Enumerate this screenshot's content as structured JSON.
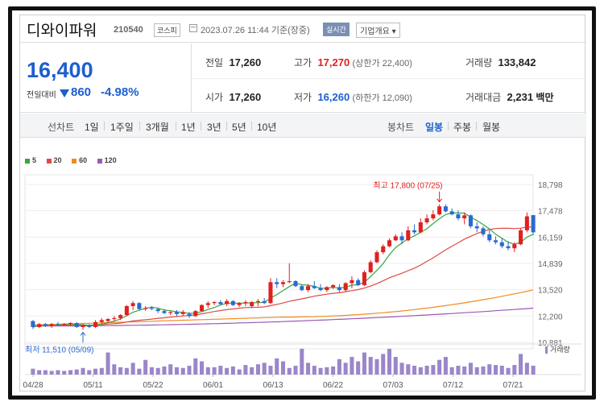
{
  "header": {
    "name": "디와이파워",
    "code": "210540",
    "market": "코스피",
    "time": "2023.07.26 11:44 기준(장중)",
    "realtime": "실시간",
    "company_info": "기업개요 ▾"
  },
  "quote": {
    "price": "16,400",
    "prev_label": "전일대비",
    "change": "860",
    "change_pct": "-4.98%",
    "prev_close_label": "전일",
    "prev_close": "17,260",
    "high_label": "고가",
    "high": "17,270",
    "upper_limit": "(상한가 22,400)",
    "volume_label": "거래량",
    "volume": "133,842",
    "open_label": "시가",
    "open": "17,260",
    "low_label": "저가",
    "low": "16,260",
    "lower_limit": "(하한가 12,090)",
    "amount_label": "거래대금",
    "amount": "2,231",
    "amount_unit": "백만"
  },
  "tabs": {
    "line_label": "선차트",
    "periods": [
      "1일",
      "1주일",
      "3개월",
      "1년",
      "3년",
      "5년",
      "10년"
    ],
    "candle_label": "봉차트",
    "candles": [
      "일봉",
      "주봉",
      "월봉"
    ],
    "selected_candle": "일봉"
  },
  "legend": [
    {
      "label": "5",
      "color": "#3aa63a"
    },
    {
      "label": "20",
      "color": "#e04848"
    },
    {
      "label": "60",
      "color": "#f08c1e"
    },
    {
      "label": "120",
      "color": "#9b59b6"
    }
  ],
  "volume_legend": "거래량",
  "chart_data": {
    "type": "candlestick",
    "y_ticks": [
      "18,798",
      "17,478",
      "16,159",
      "14,839",
      "13,520",
      "12,200",
      "10,881"
    ],
    "ylim": [
      10881,
      18798
    ],
    "x_ticks": [
      "04/28",
      "05/11",
      "05/22",
      "06/01",
      "06/13",
      "06/22",
      "07/03",
      "07/12",
      "07/21"
    ],
    "max_annotation": "최고 17,800 (07/25)",
    "min_annotation": "최저 11,510 (05/09)",
    "candles": [
      [
        11950,
        12000,
        11550,
        11650
      ],
      [
        11650,
        11850,
        11600,
        11800
      ],
      [
        11800,
        11850,
        11650,
        11700
      ],
      [
        11700,
        11850,
        11600,
        11800
      ],
      [
        11800,
        11900,
        11700,
        11750
      ],
      [
        11750,
        11850,
        11700,
        11800
      ],
      [
        11800,
        11900,
        11700,
        11850
      ],
      [
        11850,
        11900,
        11600,
        11650
      ],
      [
        11650,
        11800,
        11510,
        11750
      ],
      [
        11700,
        11800,
        11600,
        11650
      ],
      [
        11650,
        12000,
        11600,
        11900
      ],
      [
        11900,
        12100,
        11800,
        12000
      ],
      [
        11950,
        12100,
        11850,
        12050
      ],
      [
        12050,
        12200,
        11950,
        12100
      ],
      [
        12100,
        12300,
        12000,
        12250
      ],
      [
        12250,
        12750,
        12200,
        12700
      ],
      [
        12700,
        12950,
        12500,
        12850
      ],
      [
        12850,
        12900,
        12500,
        12550
      ],
      [
        12550,
        12700,
        12450,
        12600
      ],
      [
        12600,
        12700,
        12500,
        12550
      ],
      [
        12550,
        12600,
        12350,
        12450
      ],
      [
        12450,
        12550,
        12300,
        12350
      ],
      [
        12350,
        12450,
        12250,
        12400
      ],
      [
        12400,
        12500,
        12200,
        12300
      ],
      [
        12300,
        12500,
        12200,
        12400
      ],
      [
        12300,
        12400,
        12100,
        12200
      ],
      [
        12200,
        12500,
        12150,
        12450
      ],
      [
        12450,
        12800,
        12400,
        12750
      ],
      [
        12750,
        12950,
        12600,
        12850
      ],
      [
        12850,
        12950,
        12750,
        12900
      ],
      [
        12900,
        13000,
        12750,
        12800
      ],
      [
        12800,
        13050,
        12700,
        12950
      ],
      [
        12950,
        13000,
        12700,
        12750
      ],
      [
        12750,
        12900,
        12650,
        12850
      ],
      [
        12850,
        13000,
        12700,
        12900
      ],
      [
        12700,
        12950,
        12600,
        12900
      ],
      [
        12900,
        13050,
        12700,
        12950
      ],
      [
        12950,
        13100,
        12800,
        12850
      ],
      [
        12850,
        14100,
        12800,
        13900
      ],
      [
        13900,
        14100,
        13600,
        13800
      ],
      [
        13800,
        14000,
        13650,
        13900
      ],
      [
        13900,
        14850,
        13850,
        13950
      ],
      [
        13950,
        14000,
        13650,
        13700
      ],
      [
        13700,
        13800,
        13450,
        13500
      ],
      [
        13500,
        13800,
        13400,
        13700
      ],
      [
        13700,
        13950,
        13550,
        13600
      ],
      [
        13600,
        13800,
        13450,
        13500
      ],
      [
        13500,
        13700,
        13400,
        13650
      ],
      [
        13650,
        13800,
        13550,
        13750
      ],
      [
        13650,
        13800,
        13400,
        13500
      ],
      [
        13500,
        13900,
        13450,
        13850
      ],
      [
        13850,
        14200,
        13600,
        14000
      ],
      [
        14000,
        14100,
        13700,
        13750
      ],
      [
        13750,
        14500,
        13700,
        14400
      ],
      [
        14400,
        15000,
        14350,
        14900
      ],
      [
        14900,
        15500,
        14850,
        15400
      ],
      [
        15400,
        15800,
        15300,
        15700
      ],
      [
        15700,
        16100,
        15650,
        16000
      ],
      [
        16000,
        16300,
        15950,
        16200
      ],
      [
        16200,
        16400,
        15800,
        16000
      ],
      [
        16000,
        16700,
        15950,
        16500
      ],
      [
        16500,
        16800,
        16300,
        16400
      ],
      [
        16400,
        17100,
        16350,
        16900
      ],
      [
        16900,
        17300,
        16800,
        17100
      ],
      [
        17100,
        17500,
        17000,
        17300
      ],
      [
        17300,
        17800,
        17250,
        17700
      ],
      [
        17700,
        17800,
        17400,
        17450
      ],
      [
        17450,
        17600,
        17250,
        17300
      ],
      [
        17300,
        17500,
        17000,
        17100
      ],
      [
        17100,
        17400,
        16800,
        17250
      ],
      [
        17250,
        17300,
        16600,
        16700
      ],
      [
        16700,
        16900,
        16400,
        16600
      ],
      [
        16600,
        16700,
        16200,
        16300
      ],
      [
        16300,
        16500,
        15900,
        16000
      ],
      [
        16000,
        16200,
        15800,
        15900
      ],
      [
        15900,
        16100,
        15600,
        15700
      ],
      [
        15700,
        15950,
        15500,
        15600
      ],
      [
        15600,
        15900,
        15400,
        15800
      ],
      [
        15800,
        16600,
        15750,
        16500
      ],
      [
        16500,
        17400,
        16400,
        17200
      ],
      [
        17260,
        17270,
        16260,
        16400
      ]
    ],
    "volumes": [
      8,
      6,
      6,
      5,
      6,
      5,
      6,
      7,
      9,
      6,
      8,
      9,
      30,
      14,
      10,
      9,
      16,
      8,
      20,
      10,
      9,
      11,
      14,
      10,
      9,
      12,
      22,
      18,
      10,
      10,
      12,
      9,
      11,
      7,
      13,
      10,
      14,
      16,
      12,
      22,
      18,
      9,
      12,
      35,
      16,
      12,
      9,
      10,
      11,
      21,
      16,
      24,
      18,
      30,
      24,
      21,
      28,
      35,
      24,
      16,
      14,
      12,
      10,
      12,
      13,
      20,
      24,
      10,
      12,
      11,
      16,
      10,
      11,
      14,
      13,
      12,
      9,
      13,
      28,
      16,
      12
    ]
  }
}
